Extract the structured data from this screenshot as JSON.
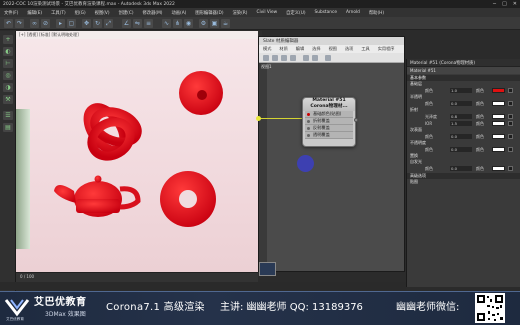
{
  "window": {
    "title": "2022-COC 10渲染测试场景 - 艾巴优教育渲染课程.max - Autodesk 3ds Max 2022",
    "controls": [
      "─",
      "□",
      "✕"
    ]
  },
  "menubar": {
    "items": [
      "文件(F)",
      "编辑(E)",
      "工具(T)",
      "组(G)",
      "视图(V)",
      "创建(C)",
      "修改器(M)",
      "动画(A)",
      "图形编辑器(D)",
      "渲染(R)",
      "Civil View",
      "自定义(U)",
      "Substance",
      "Arnold",
      "帮助(H)"
    ]
  },
  "viewport": {
    "label": "[+] [透视] [标准] [默认明暗处理]"
  },
  "slate": {
    "title": "Slate 材质编辑器",
    "menu": [
      "模式",
      "材质",
      "编辑",
      "选择",
      "视图",
      "选项",
      "工具",
      "实用程序"
    ],
    "view_label": "视图1",
    "node": {
      "title_line1": "Material #51",
      "title_line2": "Corona物理材...",
      "slots": [
        "基础颜色(贴图)",
        "折射覆盖",
        "反射覆盖",
        "透明覆盖"
      ]
    }
  },
  "properties": {
    "header": "Material #51 (Corona物理材质)",
    "subheader": "Material #51",
    "rollouts": [
      "基本参数",
      "高级选项"
    ],
    "rows": [
      {
        "label": "颜色",
        "value": "1.0",
        "label2": "颜色",
        "swatch": "#e01010"
      },
      {
        "label": "颜色",
        "value": "0.0",
        "label2": "颜色",
        "swatch": "#ffffff"
      },
      {
        "label": "光泽度",
        "value": "0.8",
        "label2": "颜色",
        "swatch": "#ffffff"
      },
      {
        "label": "IOR",
        "value": "1.5",
        "label2": "颜色",
        "swatch": "#ffffff"
      },
      {
        "label": "颜色",
        "value": "0.0",
        "label2": "颜色",
        "swatch": "#ffffff"
      },
      {
        "label": "颜色",
        "value": "0.0",
        "label2": "颜色",
        "swatch": "#ffffff"
      },
      {
        "label": "颜色",
        "value": "0.0",
        "label2": "颜色",
        "swatch": "#ffffff"
      }
    ],
    "sections": [
      "基础层",
      "半透明",
      "折射",
      "次表面",
      "不透明度",
      "置换",
      "自发光",
      "贴图"
    ]
  },
  "timeline": {
    "text": "0 / 100"
  },
  "banner": {
    "brand": "艾巴优教育",
    "brand_sub": "3DMax 效果图",
    "brand_small": "艾巴优教育",
    "course": "Corona7.1 高级渲染",
    "teacher": "主讲: 幽幽老师 QQ: 13189376",
    "wechat": "幽幽老师微信:"
  },
  "colors": {
    "object_red": "#e0101c",
    "node_wire": "#d4d432",
    "cursor": "#3c3fbd"
  }
}
